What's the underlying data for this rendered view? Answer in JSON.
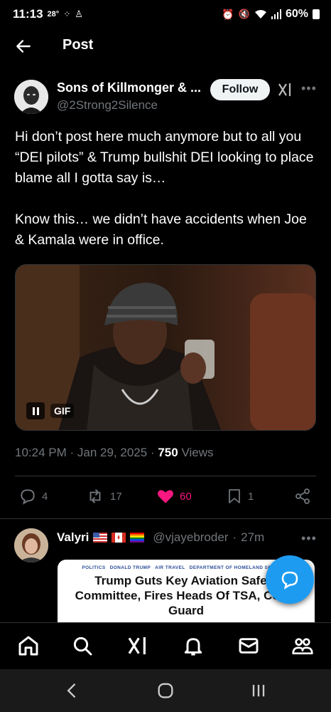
{
  "status_bar": {
    "time": "11:13",
    "temperature": "28°",
    "battery": "60%"
  },
  "header": {
    "title": "Post",
    "back_icon": "arrow-left-icon"
  },
  "post": {
    "author": {
      "display_name": "Sons of Killmonger & ...",
      "handle": "@2Strong2Silence"
    },
    "follow_label": "Follow",
    "paragraphs": [
      "Hi don’t post here much anymore but to all you “DEI pilots” & Trump bullshit DEI looking to place blame all I gotta say is…",
      "Know this… we didn’t have accidents when Joe & Kamala were in office."
    ],
    "media": {
      "type_label": "GIF"
    },
    "meta": {
      "time": "10:24 PM",
      "date": "Jan 29, 2025",
      "views_count": "750",
      "views_label": "Views"
    },
    "actions": {
      "replies": "4",
      "reposts": "17",
      "likes": "60",
      "bookmarks": "1"
    },
    "colors": {
      "like_active": "#f91880",
      "accent": "#1d9bf0",
      "muted": "#71767b"
    }
  },
  "reply": {
    "display_name": "Valyri",
    "handle": "@vjayebroder",
    "time_ago": "27m",
    "flags": [
      "us-flag",
      "canada-flag",
      "rainbow-flag"
    ],
    "article": {
      "categories": [
        "POLITICS",
        "DONALD TRUMP",
        "AIR TRAVEL",
        "DEPARTMENT OF HOMELAND SECURITY"
      ],
      "headline": "Trump Guts Key Aviation Safety Committee, Fires Heads Of TSA, Coast Guard"
    }
  },
  "bottom_nav": [
    "home-icon",
    "search-icon",
    "grok-icon",
    "notifications-icon",
    "messages-icon",
    "communities-icon"
  ],
  "system_nav": [
    "back-icon",
    "home-icon",
    "recents-icon"
  ]
}
